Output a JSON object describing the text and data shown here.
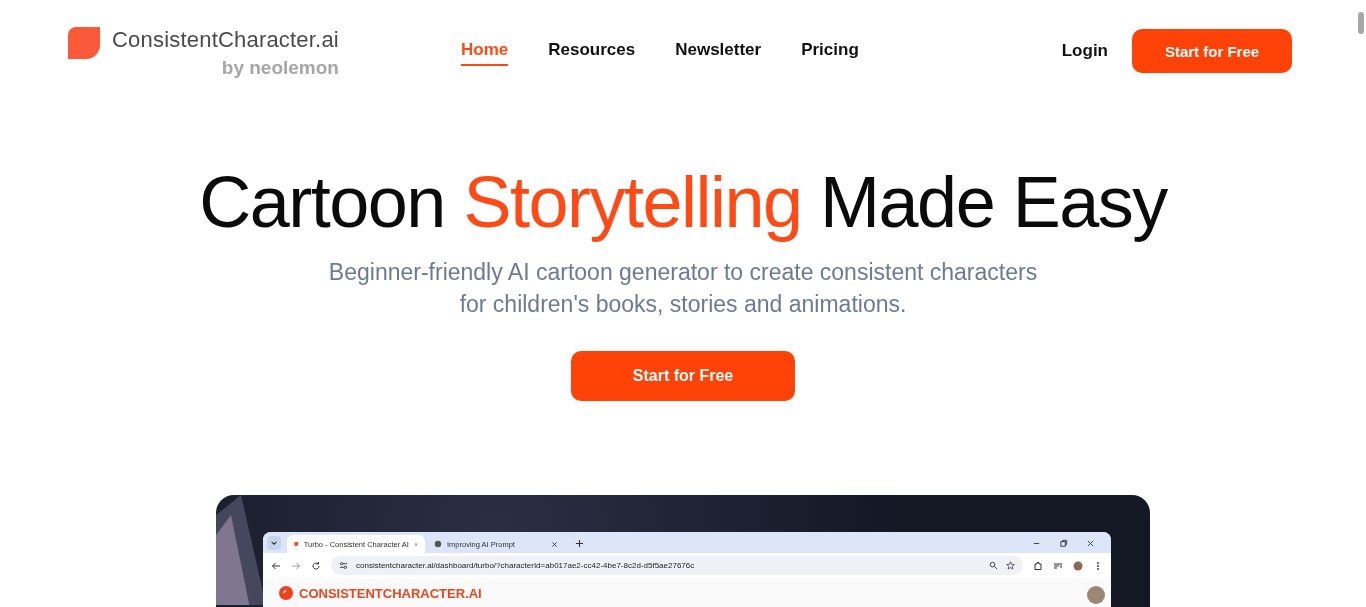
{
  "header": {
    "logo": {
      "name": "ConsistentCharacter.ai",
      "byline": "by neolemon"
    },
    "nav": [
      {
        "label": "Home",
        "selected": true
      },
      {
        "label": "Resources",
        "selected": false
      },
      {
        "label": "Newsletter",
        "selected": false
      },
      {
        "label": "Pricing",
        "selected": false
      }
    ],
    "login": "Login",
    "cta": "Start for Free"
  },
  "hero": {
    "title": [
      {
        "text": "Cartoon ",
        "accent": false
      },
      {
        "text": "Storytelling",
        "accent": true
      },
      {
        "text": " Made Easy",
        "accent": false
      }
    ],
    "subtitle": [
      "Beginner-friendly AI cartoon generator to create consistent characters",
      "for children's books, stories and animations."
    ],
    "cta": "Start for Free"
  },
  "demo": {
    "tabs": [
      {
        "label": "Turbo - Consistent Character AI",
        "selected": true
      },
      {
        "label": "Improving AI Prompt",
        "selected": false
      }
    ],
    "url": "consistentcharacter.ai/dashboard/turbo/?characterId=ab017ae2-cc42-4be7-8c2d-d5f5ae27676c",
    "app_title": "CONSISTENTCHARACTER.AI"
  }
}
